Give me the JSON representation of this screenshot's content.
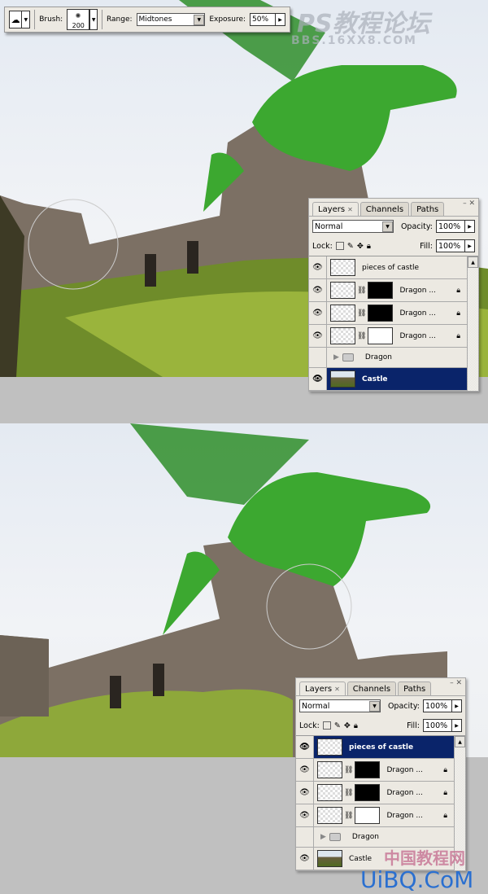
{
  "toolbar": {
    "tool_icon": "sponge-tool-icon",
    "brush_label": "Brush:",
    "brush_size": "200",
    "range_label": "Range:",
    "range_value": "Midtones",
    "exposure_label": "Exposure:",
    "exposure_value": "50%"
  },
  "watermarks": {
    "top_title": "PS教程论坛",
    "top_url": "BBS.16XX8.COM",
    "bottom_title": "中国教程网",
    "bottom_url": "UiBQ.CoM"
  },
  "colors": {
    "selected_layer": "#0a246a",
    "panel_bg": "#ece9e2"
  },
  "panels": [
    {
      "tabs": [
        "Layers",
        "Channels",
        "Paths"
      ],
      "blend_mode": "Normal",
      "opacity_label": "Opacity:",
      "opacity": "100%",
      "lock_label": "Lock:",
      "fill_label": "Fill:",
      "fill": "100%",
      "layers": [
        {
          "name": "pieces of castle",
          "visible": true,
          "type": "plain",
          "selected": false
        },
        {
          "name": "Dragon ...",
          "visible": true,
          "type": "mask-black",
          "selected": false
        },
        {
          "name": "Dragon ...",
          "visible": true,
          "type": "mask-black",
          "selected": false
        },
        {
          "name": "Dragon ...",
          "visible": true,
          "type": "mask-white",
          "selected": false
        },
        {
          "name": "Dragon",
          "visible": false,
          "type": "group",
          "selected": false
        },
        {
          "name": "Castle",
          "visible": true,
          "type": "castle",
          "selected": true
        }
      ]
    },
    {
      "tabs": [
        "Layers",
        "Channels",
        "Paths"
      ],
      "blend_mode": "Normal",
      "opacity_label": "Opacity:",
      "opacity": "100%",
      "lock_label": "Lock:",
      "fill_label": "Fill:",
      "fill": "100%",
      "layers": [
        {
          "name": "pieces of castle",
          "visible": true,
          "type": "plain",
          "selected": true
        },
        {
          "name": "Dragon ...",
          "visible": true,
          "type": "mask-black",
          "selected": false
        },
        {
          "name": "Dragon ...",
          "visible": true,
          "type": "mask-black",
          "selected": false
        },
        {
          "name": "Dragon ...",
          "visible": true,
          "type": "mask-white",
          "selected": false
        },
        {
          "name": "Dragon",
          "visible": false,
          "type": "group",
          "selected": false
        },
        {
          "name": "Castle",
          "visible": true,
          "type": "castle",
          "selected": false
        }
      ]
    }
  ]
}
